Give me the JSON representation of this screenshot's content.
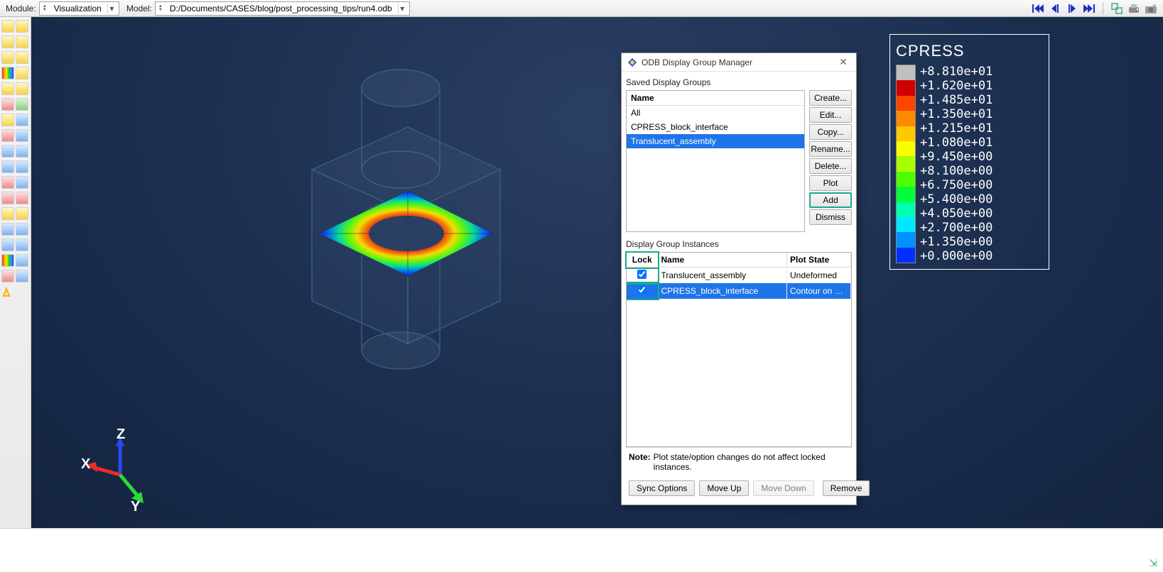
{
  "topbar": {
    "module_label": "Module:",
    "module_value": "Visualization",
    "model_label": "Model:",
    "model_path": "D:/Documents/CASES/blog/post_processing_tips/run4.odb"
  },
  "dialog": {
    "title": "ODB Display Group Manager",
    "saved_label": "Saved Display Groups",
    "name_header": "Name",
    "items": [
      "All",
      "CPRESS_block_interface",
      "Translucent_assembly"
    ],
    "selected_index": 2,
    "buttons": {
      "create": "Create...",
      "edit": "Edit...",
      "copy": "Copy...",
      "rename": "Rename...",
      "delete": "Delete...",
      "plot": "Plot",
      "add": "Add",
      "dismiss": "Dismiss"
    },
    "instances_label": "Display Group Instances",
    "inst_headers": {
      "lock": "Lock",
      "name": "Name",
      "plot": "Plot State"
    },
    "instances": [
      {
        "locked": true,
        "name": "Translucent_assembly",
        "plot_state": "Undeformed",
        "selected": false
      },
      {
        "locked": true,
        "name": "CPRESS_block_interface",
        "plot_state": "Contour on Defo",
        "selected": true
      }
    ],
    "note_label": "Note:",
    "note_text": "Plot state/option changes do not affect locked instances.",
    "bottom": {
      "sync": "Sync Options",
      "up": "Move Up",
      "down": "Move Down",
      "remove": "Remove"
    }
  },
  "legend": {
    "title": "CPRESS",
    "values": [
      "+8.810e+01",
      "+1.620e+01",
      "+1.485e+01",
      "+1.350e+01",
      "+1.215e+01",
      "+1.080e+01",
      "+9.450e+00",
      "+8.100e+00",
      "+6.750e+00",
      "+5.400e+00",
      "+4.050e+00",
      "+2.700e+00",
      "+1.350e+00",
      "+0.000e+00"
    ],
    "colors": [
      "#bfbfbf",
      "#d10000",
      "#ff4400",
      "#ff8a00",
      "#ffc800",
      "#f5ff00",
      "#a8ff00",
      "#4eff00",
      "#00ff3a",
      "#00ffb0",
      "#00e8ff",
      "#0090ff",
      "#0030ff"
    ]
  },
  "triad": {
    "x": "X",
    "y": "Y",
    "z": "Z"
  }
}
